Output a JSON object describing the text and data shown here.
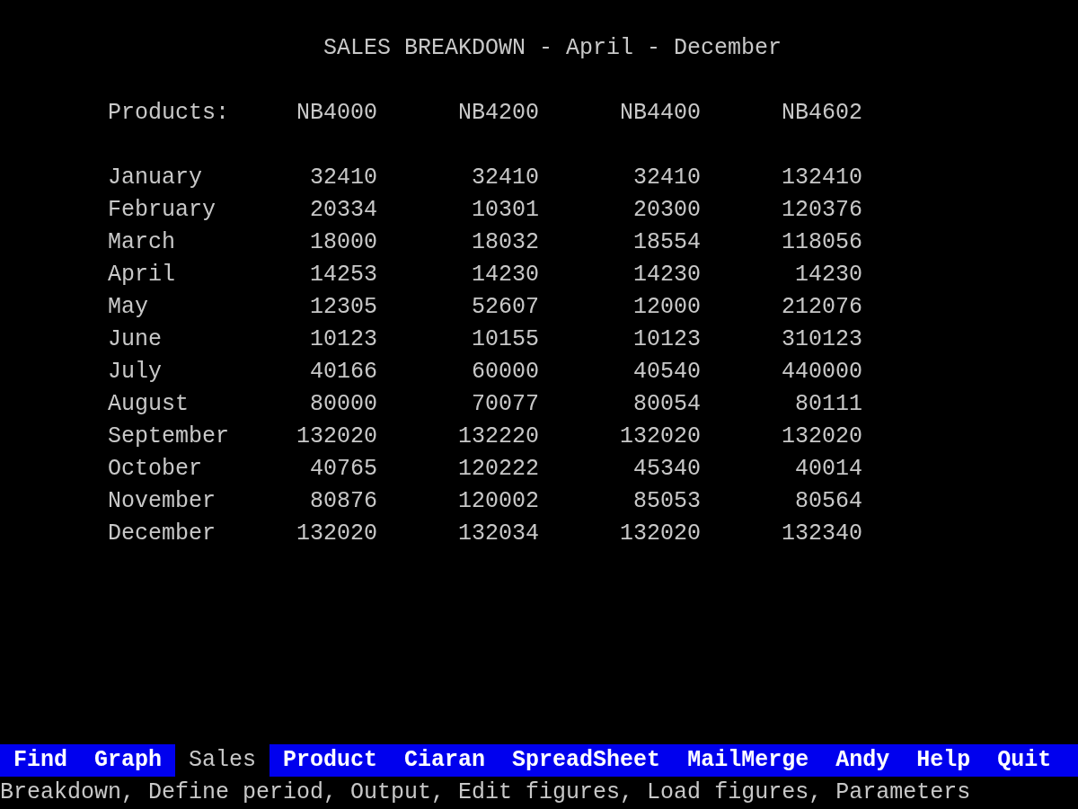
{
  "title": "SALES BREAKDOWN - April - December",
  "header": {
    "label": "Products:",
    "products": [
      "NB4000",
      "NB4200",
      "NB4400",
      "NB4602"
    ]
  },
  "rows": [
    {
      "month": "January",
      "values": [
        "32410",
        "32410",
        "32410",
        "132410"
      ]
    },
    {
      "month": "February",
      "values": [
        "20334",
        "10301",
        "20300",
        "120376"
      ]
    },
    {
      "month": "March",
      "values": [
        "18000",
        "18032",
        "18554",
        "118056"
      ]
    },
    {
      "month": "April",
      "values": [
        "14253",
        "14230",
        "14230",
        "14230"
      ]
    },
    {
      "month": "May",
      "values": [
        "12305",
        "52607",
        "12000",
        "212076"
      ]
    },
    {
      "month": "June",
      "values": [
        "10123",
        "10155",
        "10123",
        "310123"
      ]
    },
    {
      "month": "July",
      "values": [
        "40166",
        "60000",
        "40540",
        "440000"
      ]
    },
    {
      "month": "August",
      "values": [
        "80000",
        "70077",
        "80054",
        "80111"
      ]
    },
    {
      "month": "September",
      "values": [
        "132020",
        "132220",
        "132020",
        "132020"
      ]
    },
    {
      "month": "October",
      "values": [
        "40765",
        "120222",
        "45340",
        "40014"
      ]
    },
    {
      "month": "November",
      "values": [
        "80876",
        "120002",
        "85053",
        "80564"
      ]
    },
    {
      "month": "December",
      "values": [
        "132020",
        "132034",
        "132020",
        "132340"
      ]
    }
  ],
  "menu": [
    {
      "label": "Find",
      "selected": false
    },
    {
      "label": "Graph",
      "selected": false
    },
    {
      "label": "Sales",
      "selected": true
    },
    {
      "label": "Product",
      "selected": false
    },
    {
      "label": "Ciaran",
      "selected": false
    },
    {
      "label": "SpreadSheet",
      "selected": false
    },
    {
      "label": "MailMerge",
      "selected": false
    },
    {
      "label": "Andy",
      "selected": false
    },
    {
      "label": "Help",
      "selected": false
    },
    {
      "label": "Quit",
      "selected": false
    }
  ],
  "status": "Breakdown, Define period, Output, Edit figures, Load figures, Parameters"
}
